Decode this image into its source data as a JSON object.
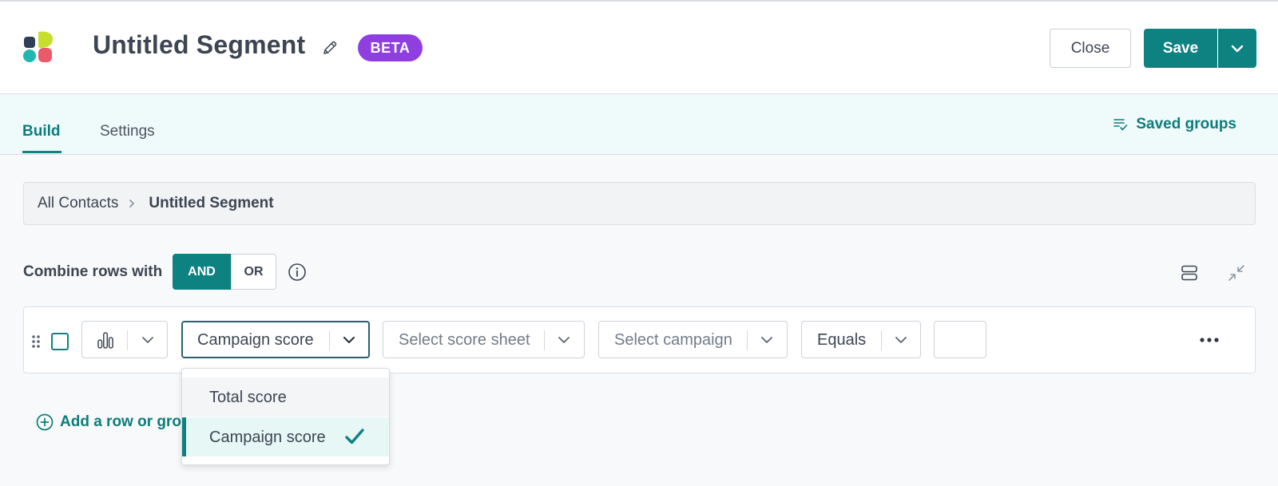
{
  "header": {
    "title": "Untitled Segment",
    "badge": "BETA",
    "close_label": "Close",
    "save_label": "Save"
  },
  "tabs": [
    {
      "label": "Build",
      "active": true
    },
    {
      "label": "Settings",
      "active": false
    }
  ],
  "saved_groups_label": "Saved groups",
  "breadcrumb": {
    "root": "All Contacts",
    "current": "Untitled Segment"
  },
  "combine": {
    "label": "Combine rows with",
    "options": [
      "AND",
      "OR"
    ],
    "selected": "AND"
  },
  "condition_row": {
    "type_icon": "bar-chart-icon",
    "field": "Campaign score",
    "score_sheet_placeholder": "Select score sheet",
    "campaign_placeholder": "Select campaign",
    "operator": "Equals",
    "value": ""
  },
  "dropdown": {
    "items": [
      {
        "label": "Total score",
        "selected": false
      },
      {
        "label": "Campaign score",
        "selected": true
      }
    ]
  },
  "add_row_label": "Add a row or group",
  "colors": {
    "accent": "#0e8281",
    "beta": "#8f3fe0",
    "tabs_bg": "#effafb"
  }
}
